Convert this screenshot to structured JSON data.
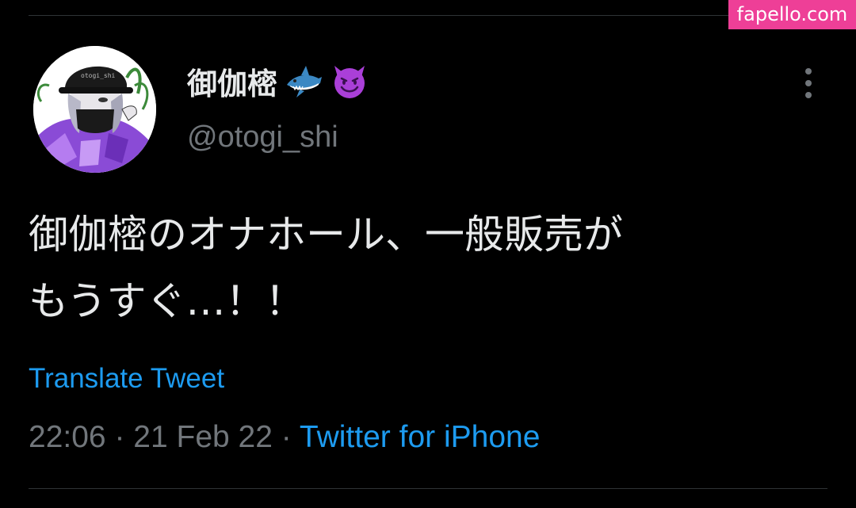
{
  "watermark": "fapello.com",
  "author": {
    "display_name": "御伽樒",
    "name_emojis": [
      "shark-emoji",
      "smiling-face-with-horns-emoji"
    ],
    "handle": "@otogi_shi",
    "avatar": "profile-avatar"
  },
  "tweet": {
    "text": "御伽樒のオナホール、一般販売が\nもうすぐ…！！",
    "translate_label": "Translate Tweet",
    "time": "22:06",
    "separator": "·",
    "date": "21 Feb 22",
    "source": "Twitter for iPhone"
  },
  "icons": {
    "more": "more-vertical-icon"
  },
  "colors": {
    "background": "#000000",
    "text_primary": "#e7e9ea",
    "text_secondary": "#71767b",
    "link": "#1d9bf0",
    "divider": "#2f3336",
    "watermark_bg": "#ee3f97"
  }
}
